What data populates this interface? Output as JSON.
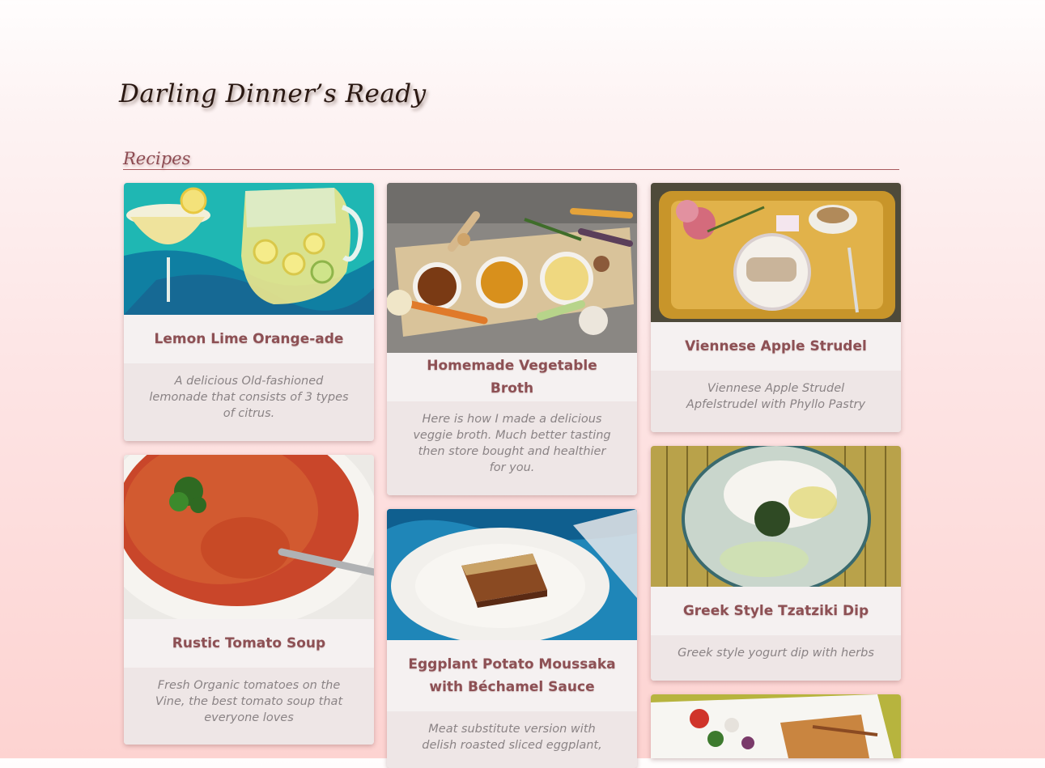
{
  "site": {
    "title": "Darling Dinner’s Ready"
  },
  "section": {
    "heading": "Recipes"
  },
  "recipes": [
    {
      "title": "Lemon Lime Orange-ade",
      "description": "A delicious Old-fashioned lemonade that consists of 3 types of citrus.",
      "image": "lemonade-pitcher-photo"
    },
    {
      "title": "Homemade Vegetable Broth",
      "description": "Here is how I made a delicious veggie broth. Much better tasting then store bought and healthier for you.",
      "image": "vegetable-broth-photo"
    },
    {
      "title": "Viennese Apple Strudel",
      "description": "Viennese Apple Strudel Apfelstrudel with Phyllo Pastry",
      "image": "apple-strudel-photo"
    },
    {
      "title": "Rustic Tomato Soup",
      "description": "Fresh Organic tomatoes on the Vine, the best tomato soup that everyone loves",
      "image": "tomato-soup-photo"
    },
    {
      "title": "Eggplant Potato Moussaka with Béchamel Sauce",
      "description": "Meat substitute version with delish roasted sliced eggplant, ",
      "image": "moussaka-photo"
    },
    {
      "title": "Greek Style Tzatziki Dip",
      "description": "Greek style yogurt dip with herbs",
      "image": "tzatziki-photo"
    },
    {
      "title": "",
      "description": "",
      "image": "greek-salad-chicken-photo"
    }
  ],
  "colors": {
    "accent": "#8d5054",
    "heading": "#8d4b52",
    "rule": "#a85a5e"
  }
}
